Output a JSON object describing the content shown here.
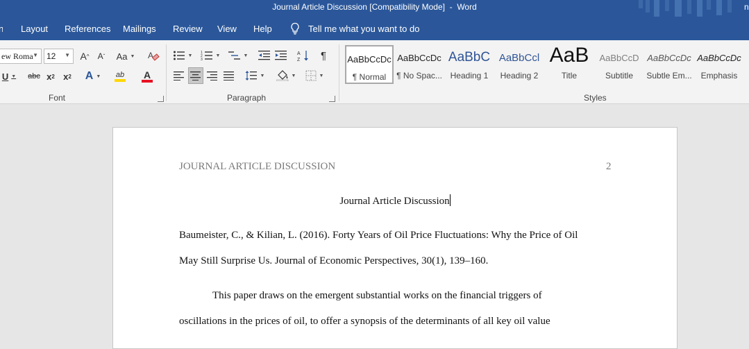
{
  "window": {
    "title": "Journal Article Discussion [Compatibility Mode]  -  Word",
    "user_initial": "n"
  },
  "menu": {
    "tabs": [
      "Layout",
      "References",
      "Mailings",
      "Review",
      "View",
      "Help"
    ],
    "tell_me": "Tell me what you want to do"
  },
  "ribbon": {
    "font": {
      "name": "ew Roma",
      "size": "12",
      "group_label": "Font",
      "grow": "A",
      "shrink": "A",
      "case": "Aa",
      "underline": "U",
      "strike": "abc",
      "subscript": "x",
      "superscript": "x",
      "text_effects": "A",
      "highlight": "ab",
      "font_color": "A"
    },
    "paragraph": {
      "group_label": "Paragraph",
      "show_marks": "¶"
    },
    "styles": {
      "group_label": "Styles",
      "items": [
        {
          "preview": "AaBbCcDc",
          "label": "¶ Normal"
        },
        {
          "preview": "AaBbCcDc",
          "label": "¶ No Spac..."
        },
        {
          "preview": "AaBbC",
          "label": "Heading 1"
        },
        {
          "preview": "AaBbCcl",
          "label": "Heading 2"
        },
        {
          "preview": "AaB",
          "label": "Title"
        },
        {
          "preview": "AaBbCcD",
          "label": "Subtitle"
        },
        {
          "preview": "AaBbCcDc",
          "label": "Subtle Em..."
        },
        {
          "preview": "AaBbCcDc",
          "label": "Emphasis"
        }
      ]
    }
  },
  "document": {
    "header_text": "JOURNAL ARTICLE DISCUSSION",
    "page_number": "2",
    "title": "Journal Article Discussion",
    "citation_line1": "Baumeister, C., & Kilian, L. (2016). Forty Years of Oil Price Fluctuations: Why the Price of Oil",
    "citation_line2": "May Still Surprise Us. Journal of Economic Perspectives, 30(1), 139–160.",
    "para_line1": "This paper draws on the emergent substantial works on the financial triggers of",
    "para_line2": "oscillations in the prices of oil, to offer a synopsis of the determinants of all key oil value"
  },
  "colors": {
    "accent": "#2b579a",
    "highlight": "#ffd800",
    "font_color": "#e81123"
  }
}
